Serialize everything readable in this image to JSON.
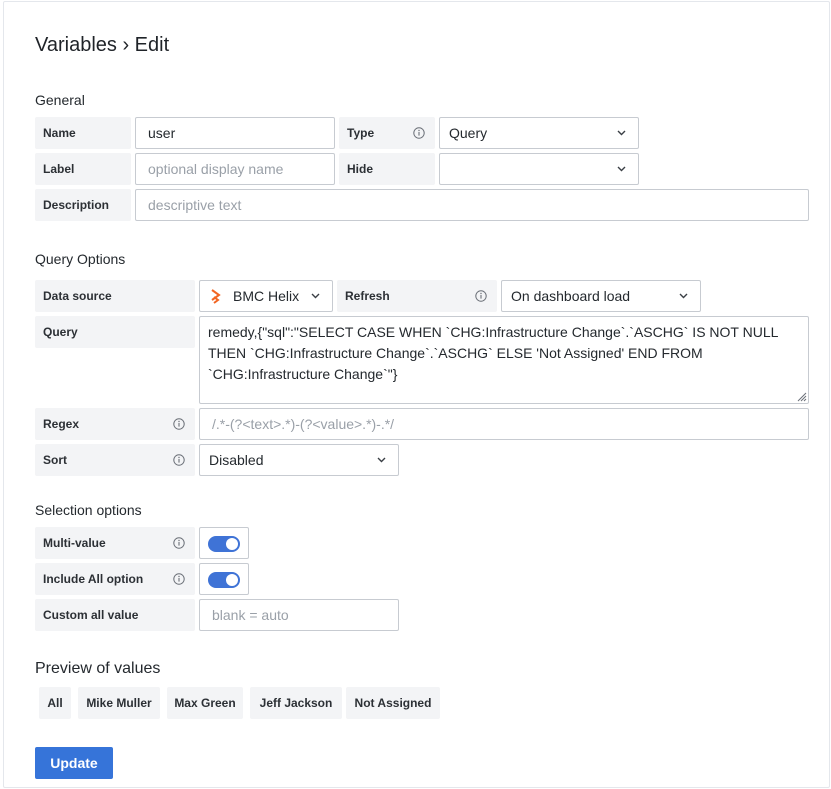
{
  "header": {
    "title": "Variables › Edit"
  },
  "general": {
    "section_title": "General",
    "name": {
      "label": "Name",
      "value": "user"
    },
    "type": {
      "label": "Type",
      "value": "Query"
    },
    "label_field": {
      "label": "Label",
      "placeholder": "optional display name"
    },
    "hide": {
      "label": "Hide",
      "value": ""
    },
    "description": {
      "label": "Description",
      "placeholder": "descriptive text"
    }
  },
  "query_options": {
    "section_title": "Query Options",
    "data_source": {
      "label": "Data source",
      "value": "BMC Helix"
    },
    "refresh": {
      "label": "Refresh",
      "value": "On dashboard load"
    },
    "query": {
      "label": "Query",
      "value": "remedy,{\"sql\":\"SELECT CASE WHEN `CHG:Infrastructure Change`.`ASCHG` IS NOT NULL THEN `CHG:Infrastructure Change`.`ASCHG` ELSE 'Not Assigned' END FROM `CHG:Infrastructure Change`\"}"
    },
    "regex": {
      "label": "Regex",
      "placeholder": "/.*-(?<text>.*)-(?<value>.*)-.*/"
    },
    "sort": {
      "label": "Sort",
      "value": "Disabled"
    }
  },
  "selection_options": {
    "section_title": "Selection options",
    "multi_value": {
      "label": "Multi-value",
      "enabled": true
    },
    "include_all": {
      "label": "Include All option",
      "enabled": true
    },
    "custom_all": {
      "label": "Custom all value",
      "placeholder": "blank = auto"
    }
  },
  "preview": {
    "section_title": "Preview of values",
    "values": [
      "All",
      "Mike Muller",
      "Max Green",
      "Jeff Jackson",
      "Not Assigned"
    ]
  },
  "actions": {
    "update_label": "Update"
  },
  "colors": {
    "accent": "#3674d9",
    "switch_on": "#3f73d6",
    "brand_orange": "#f26522"
  },
  "icons": {
    "info": "info-circle-icon",
    "chevron": "chevron-down-icon",
    "datasource": "bmc-helix-logo-icon",
    "resize": "resize-grip-icon"
  }
}
